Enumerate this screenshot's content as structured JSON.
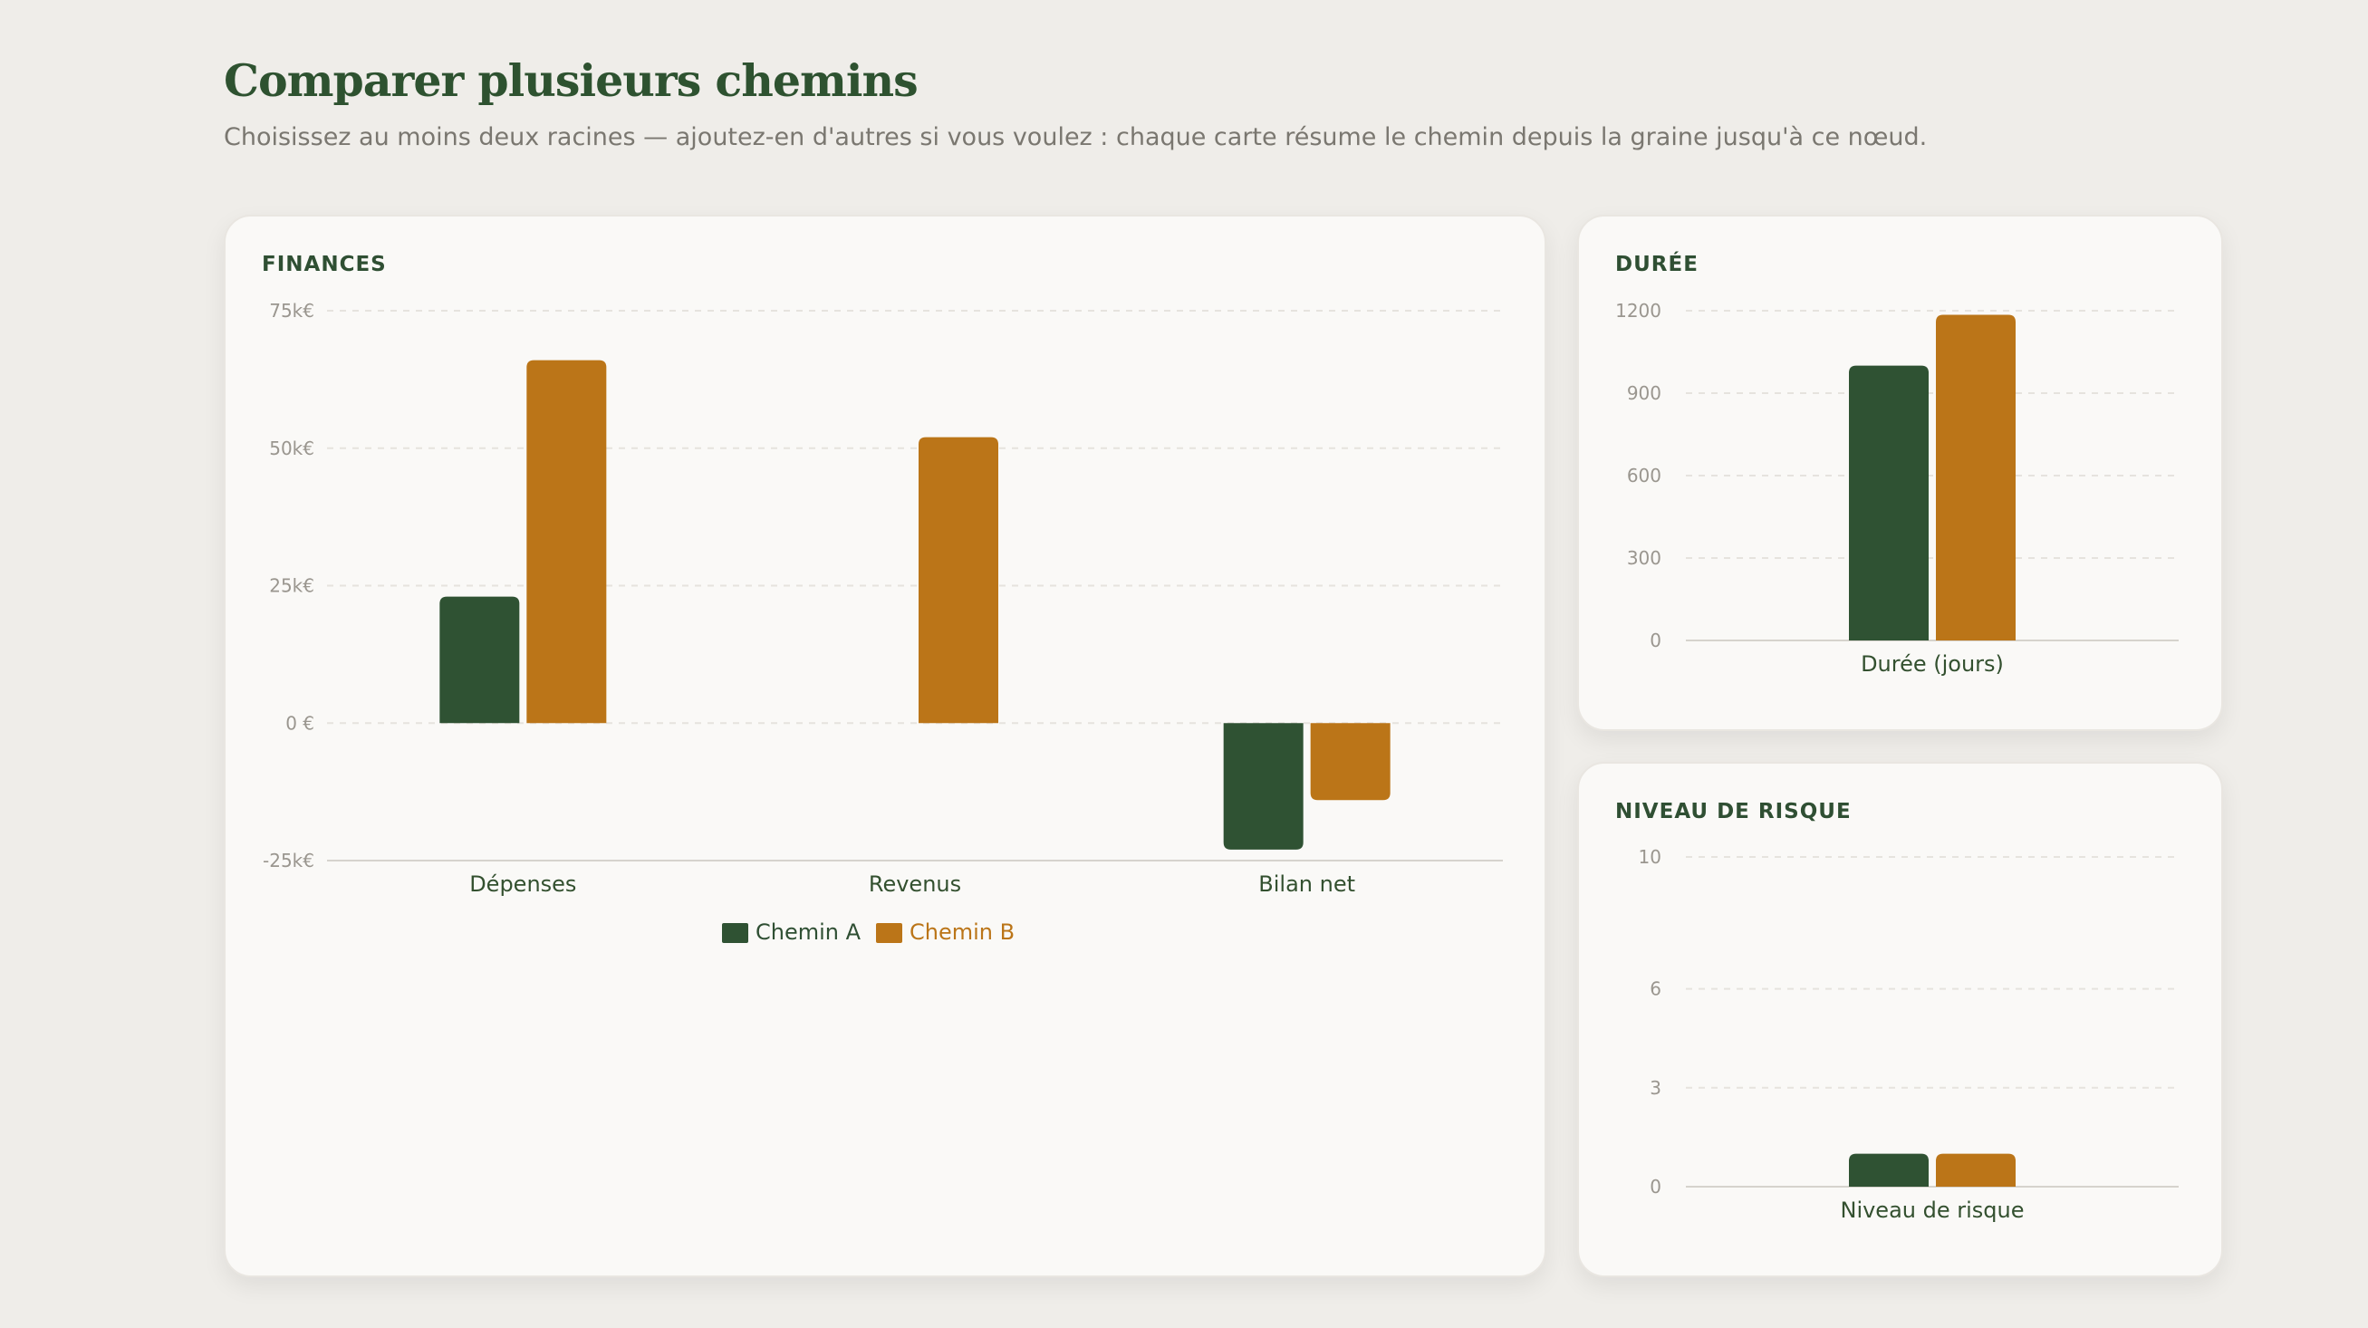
{
  "header": {
    "title": "Comparer plusieurs chemins",
    "subtitle": "Choisissez au moins deux racines — ajoutez-en d'autres si vous voulez : chaque carte résume le chemin depuis la graine jusqu'à ce nœud."
  },
  "colors": {
    "chemin_a": "#2f5233",
    "chemin_b": "#bb7518"
  },
  "chart_data": [
    {
      "id": "finances",
      "type": "bar",
      "title": "FINANCES",
      "categories": [
        "Dépenses",
        "Revenus",
        "Bilan net"
      ],
      "series": [
        {
          "name": "Chemin A",
          "values": [
            23000,
            0,
            -23000
          ]
        },
        {
          "name": "Chemin B",
          "values": [
            66000,
            52000,
            -14000
          ]
        }
      ],
      "ylim": [
        -25000,
        75000
      ],
      "yticks": [
        75000,
        50000,
        25000,
        0,
        -25000
      ],
      "ytick_labels": [
        "75k€",
        "50k€",
        "25k€",
        "0 €",
        "-25k€"
      ],
      "grid": true,
      "legend": "bottom-center"
    },
    {
      "id": "duree",
      "type": "bar",
      "title": "DURÉE",
      "categories": [
        "Durée (jours)"
      ],
      "series": [
        {
          "name": "Chemin A",
          "values": [
            1000
          ]
        },
        {
          "name": "Chemin B",
          "values": [
            1185
          ]
        }
      ],
      "ylim": [
        0,
        1200
      ],
      "yticks": [
        1200,
        900,
        600,
        300,
        0
      ],
      "ytick_labels": [
        "1200",
        "900",
        "600",
        "300",
        "0"
      ],
      "grid": true
    },
    {
      "id": "risque",
      "type": "bar",
      "title": "NIVEAU DE RISQUE",
      "categories": [
        "Niveau de risque"
      ],
      "series": [
        {
          "name": "Chemin A",
          "values": [
            1
          ]
        },
        {
          "name": "Chemin B",
          "values": [
            1
          ]
        }
      ],
      "ylim": [
        0,
        10
      ],
      "yticks": [
        10,
        6,
        3,
        0
      ],
      "ytick_labels": [
        "10",
        "6",
        "3",
        "0"
      ],
      "grid": true
    }
  ]
}
